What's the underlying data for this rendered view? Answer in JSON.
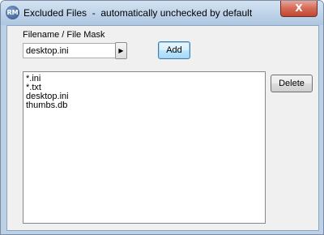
{
  "window": {
    "app_icon_text": "RM",
    "title": "Excluded Files  -  automatically unchecked by default",
    "close_glyph": "X"
  },
  "form": {
    "filename_label": "Filename / File Mask",
    "filename_value": "desktop.ini",
    "arrow_glyph": "▶",
    "add_label": "Add",
    "delete_label": "Delete"
  },
  "list": {
    "items": [
      "*.ini",
      "*.txt",
      "desktop.ini",
      "thumbs.db"
    ]
  }
}
